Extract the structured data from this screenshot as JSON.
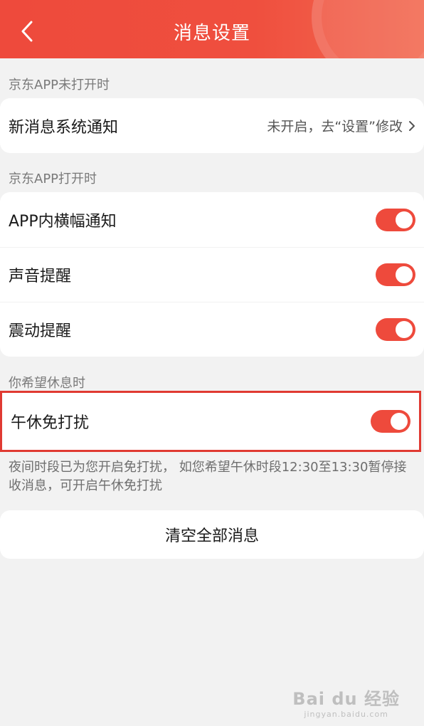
{
  "header": {
    "title": "消息设置",
    "back_icon": "chevron-left-icon",
    "color": "#ee4a3c"
  },
  "sections": {
    "closed_label": "京东APP未打开时",
    "open_label": "京东APP打开时",
    "rest_label": "你希望休息时"
  },
  "system_notify": {
    "label": "新消息系统通知",
    "value": "未开启，去“设置”修改"
  },
  "open_items": [
    {
      "label": "APP内横幅通知",
      "on": true
    },
    {
      "label": "声音提醒",
      "on": true
    },
    {
      "label": "震动提醒",
      "on": true
    }
  ],
  "noon_dnd": {
    "label": "午休免打扰",
    "on": true
  },
  "note": "夜间时段已为您开启免打扰， 如您希望午休时段12:30至13:30暂停接收消息，可开启午休免打扰",
  "clear_button": "清空全部消息",
  "watermark": {
    "brand": "Bai du 经验",
    "url": "jingyan.baidu.com"
  },
  "colors": {
    "accent": "#ee4a3c",
    "highlight_border": "#e03a32"
  }
}
